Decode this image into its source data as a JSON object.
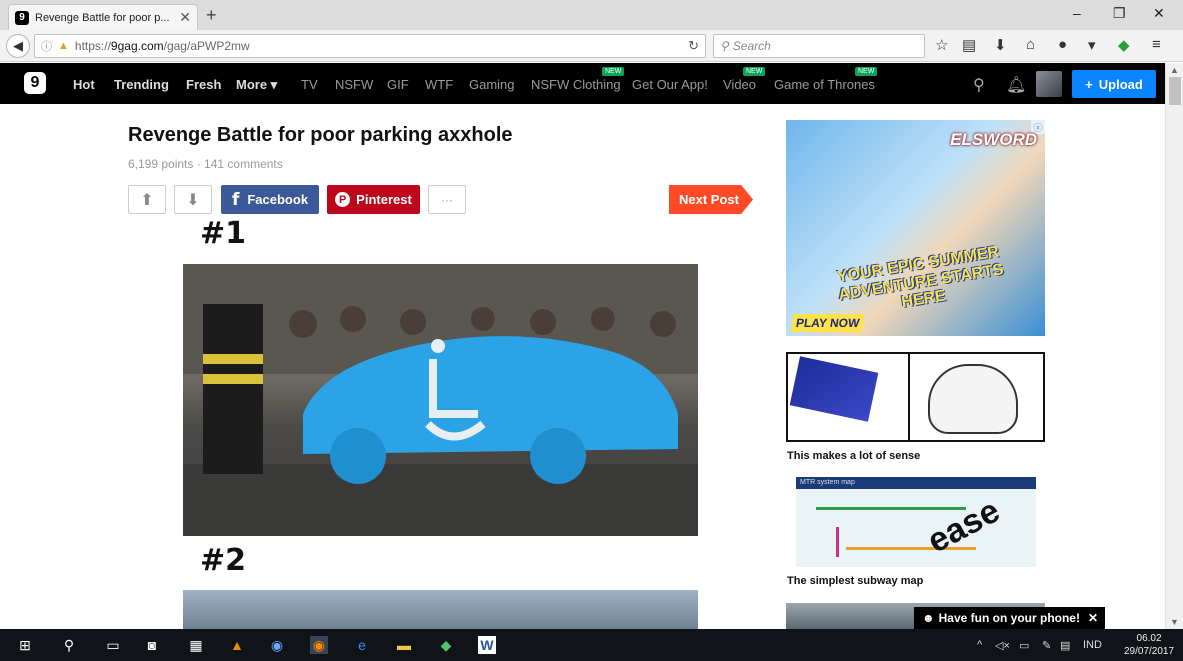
{
  "browser": {
    "tab_title": "Revenge Battle for poor p...",
    "new_tab": "+",
    "url_prefix": "https://",
    "url_host": "9gag.com",
    "url_path": "/gag/aPWP2mw",
    "search_placeholder": "Search"
  },
  "site_nav": {
    "items": [
      {
        "label": "Hot",
        "bold": true
      },
      {
        "label": "Trending",
        "bold": true
      },
      {
        "label": "Fresh",
        "bold": true
      },
      {
        "label": "More ▾",
        "bold": true
      },
      {
        "label": "TV"
      },
      {
        "label": "NSFW"
      },
      {
        "label": "GIF"
      },
      {
        "label": "WTF"
      },
      {
        "label": "Gaming"
      },
      {
        "label": "NSFW Clothing",
        "badge": "NEW"
      },
      {
        "label": "Get Our App!"
      },
      {
        "label": "Video",
        "badge": "NEW"
      },
      {
        "label": "Game of Thrones",
        "badge": "NEW"
      }
    ],
    "upload_label": "Upload"
  },
  "post": {
    "title": "Revenge Battle for poor parking axxhole",
    "meta": "6,199 points · 141 comments",
    "facebook": "Facebook",
    "pinterest": "Pinterest",
    "more": "···",
    "next_post": "Next Post",
    "section1": "#1",
    "section2": "#2"
  },
  "sidebar": {
    "ad_brand": "ELSWORD",
    "ad_tagline": "YOUR EPIC SUMMER ADVENTURE STARTS HERE",
    "ad_cta": "PLAY NOW",
    "items": [
      {
        "caption": "This makes a lot of sense"
      },
      {
        "caption": "The simplest subway map",
        "map_header": "MTR system map",
        "overlay_text": "ease"
      }
    ]
  },
  "toast": "Have fun on your phone!",
  "taskbar": {
    "lang": "IND",
    "time": "06.02",
    "date": "29/07/2017"
  },
  "colors": {
    "facebook": "#3b5998",
    "pinterest": "#bd081c",
    "next_post": "#ff4a28",
    "upload": "#0a84ff"
  }
}
